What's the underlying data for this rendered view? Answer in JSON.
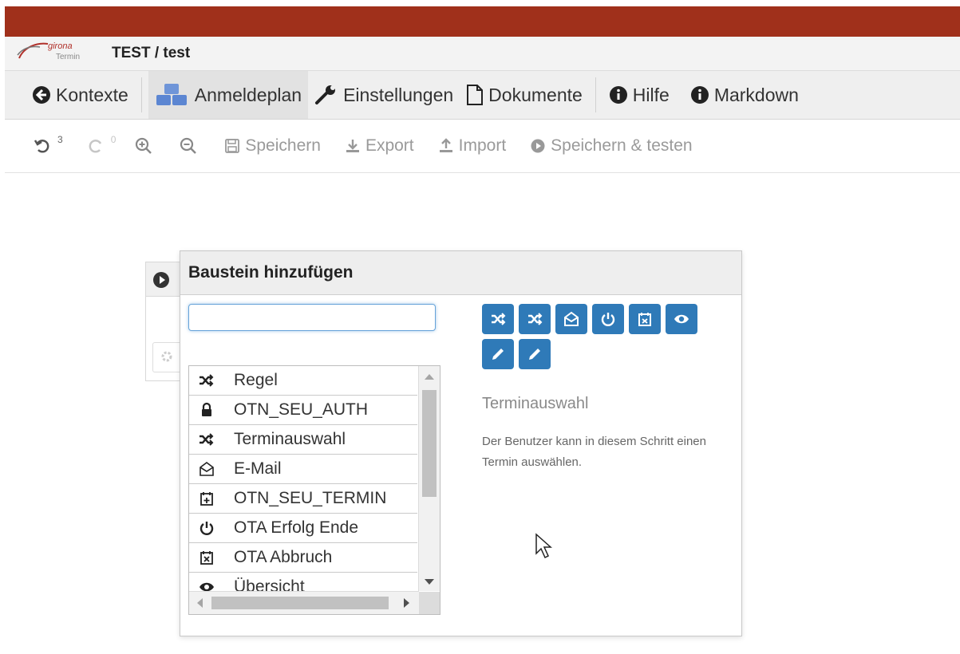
{
  "brand": {
    "logo_text_top": "girona",
    "logo_text_bottom": "Termin",
    "title": "TEST / test"
  },
  "nav": {
    "items": [
      {
        "label": "Kontexte",
        "icon": "circle-arrow-left-icon"
      },
      {
        "label": "Anmeldeplan",
        "icon": "cubes-icon",
        "active": true
      },
      {
        "label": "Einstellungen",
        "icon": "wrench-icon"
      },
      {
        "label": "Dokumente",
        "icon": "file-icon"
      },
      {
        "label": "Hilfe",
        "icon": "info-circle-icon"
      },
      {
        "label": "Markdown",
        "icon": "info-circle-icon"
      }
    ]
  },
  "toolbar": {
    "undo_count": "3",
    "redo_count": "0",
    "save_label": "Speichern",
    "export_label": "Export",
    "import_label": "Import",
    "save_test_label": "Speichern & testen"
  },
  "dialog": {
    "title": "Baustein hinzufügen",
    "search_value": "",
    "buttons": [
      "shuffle-icon",
      "shuffle-icon",
      "envelope-open-icon",
      "power-icon",
      "calendar-x-icon",
      "eye-icon",
      "pencil-icon",
      "pencil-icon"
    ],
    "list": [
      {
        "label": "Regel",
        "icon": "shuffle-icon"
      },
      {
        "label": "OTN_SEU_AUTH",
        "icon": "lock-icon"
      },
      {
        "label": "Terminauswahl",
        "icon": "shuffle-icon"
      },
      {
        "label": "E-Mail",
        "icon": "envelope-open-icon"
      },
      {
        "label": "OTN_SEU_TERMIN",
        "icon": "calendar-plus-icon"
      },
      {
        "label": "OTA Erfolg Ende",
        "icon": "power-icon"
      },
      {
        "label": "OTA Abbruch",
        "icon": "calendar-x-icon"
      },
      {
        "label": "Übersicht",
        "icon": "eye-icon"
      }
    ],
    "description_title": "Terminauswahl",
    "description_text": "Der Benutzer kann in diesem Schritt einen Termin auswählen."
  },
  "colors": {
    "topbar": "#a0301b",
    "button_blue": "#2f7ab8"
  }
}
